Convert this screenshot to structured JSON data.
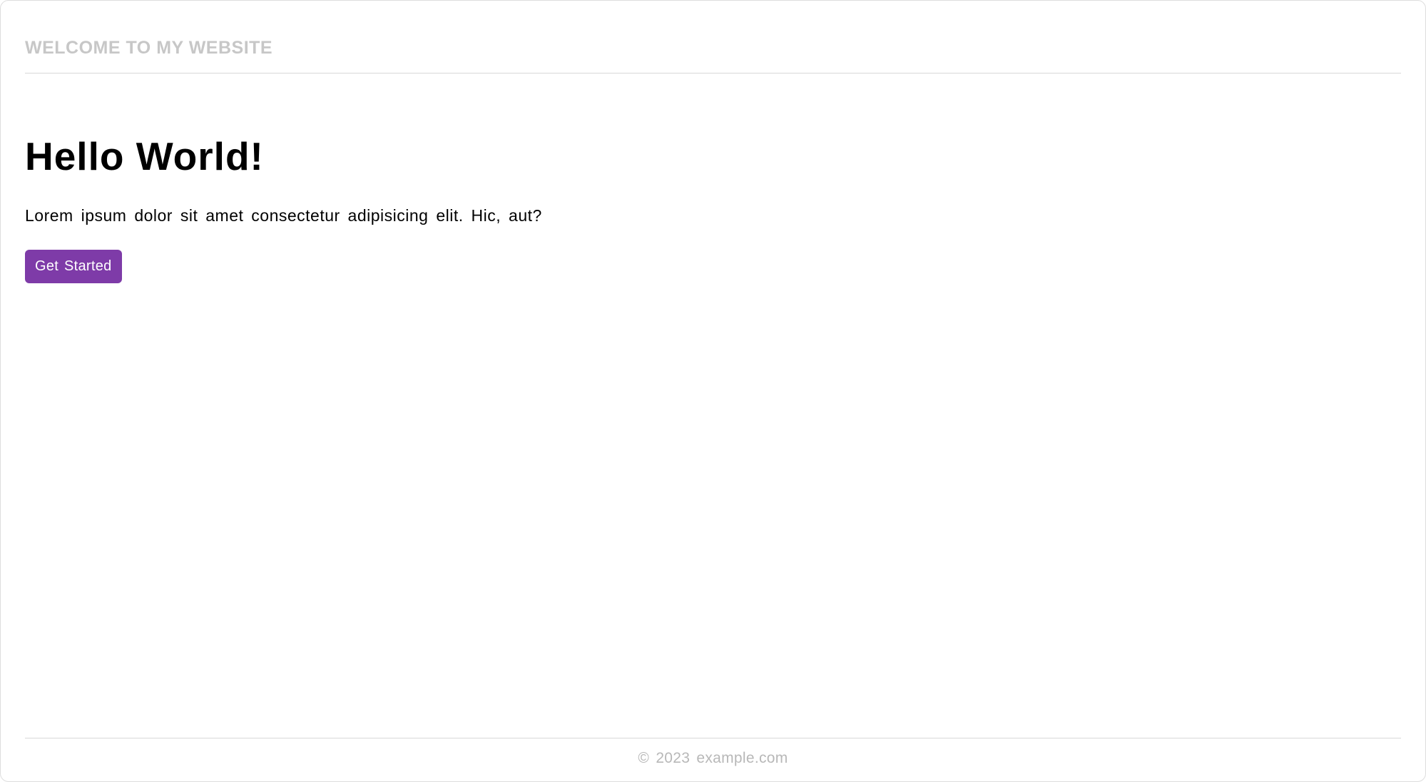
{
  "header": {
    "title": "WELCOME TO MY WEBSITE"
  },
  "main": {
    "heading": "Hello World!",
    "description": "Lorem ipsum dolor sit amet consectetur adipisicing elit. Hic, aut?",
    "button_label": "Get Started"
  },
  "footer": {
    "text": "© 2023 example.com"
  }
}
